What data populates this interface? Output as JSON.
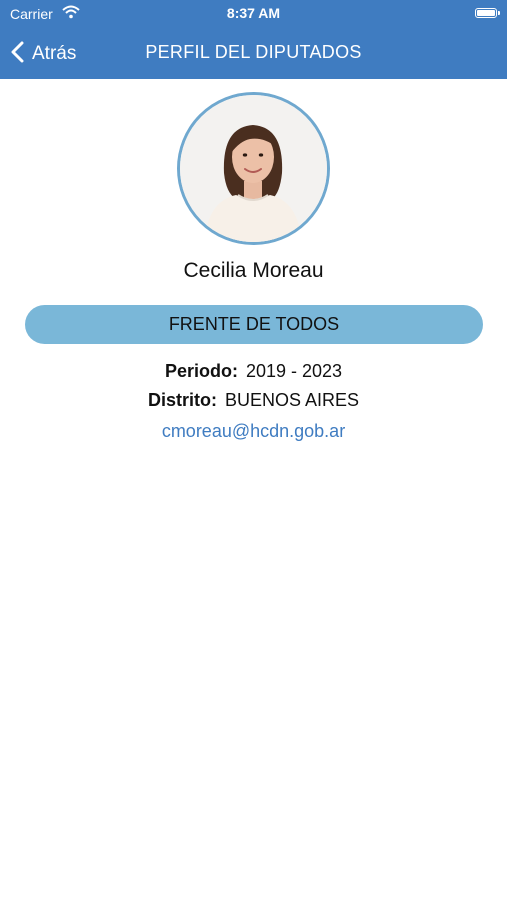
{
  "status_bar": {
    "carrier": "Carrier",
    "time": "8:37 AM"
  },
  "nav": {
    "back_label": "Atrás",
    "title": "PERFIL DEL DIPUTADOS"
  },
  "profile": {
    "name": "Cecilia Moreau",
    "party": "FRENTE DE TODOS",
    "period_label": "Periodo:",
    "period_value": "2019 - 2023",
    "district_label": "Distrito:",
    "district_value": "BUENOS AIRES",
    "email": "cmoreau@hcdn.gob.ar"
  },
  "colors": {
    "header": "#3f7cc1",
    "party_pill": "#7ab7d8",
    "avatar_border": "#6fa8cf",
    "link": "#3f7cc1"
  }
}
